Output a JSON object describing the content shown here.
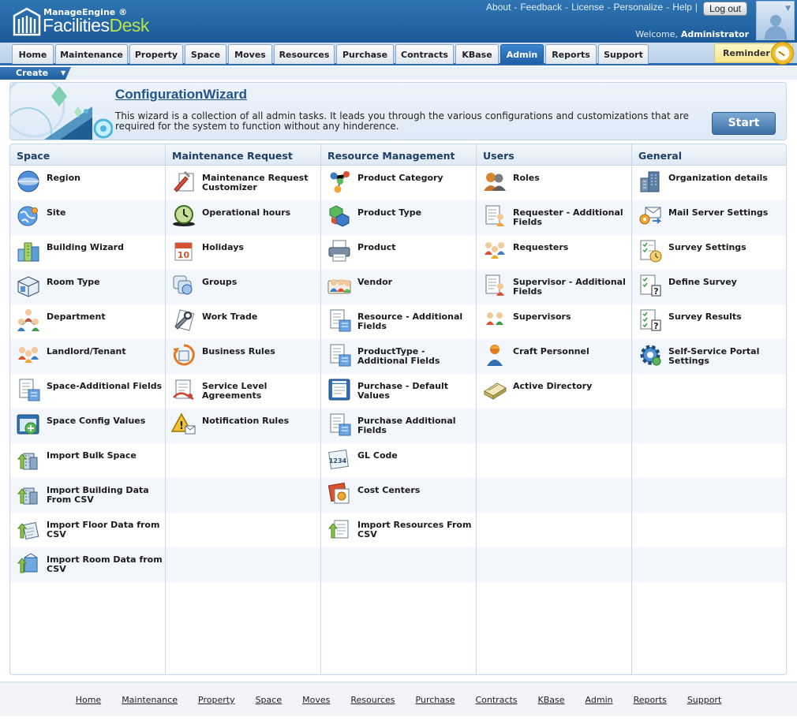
{
  "header": {
    "brand_small": "ManageEngine ®",
    "brand_big_a": "Facilities",
    "brand_big_b": "Desk",
    "top_links": [
      "About",
      "Feedback",
      "License",
      "Personalize",
      "Help"
    ],
    "logout_label": "Log out",
    "welcome_label": "Welcome,",
    "user_name": "Administrator"
  },
  "tabs": [
    {
      "label": "Home"
    },
    {
      "label": "Maintenance"
    },
    {
      "label": "Property"
    },
    {
      "label": "Space"
    },
    {
      "label": "Moves"
    },
    {
      "label": "Resources"
    },
    {
      "label": "Purchase"
    },
    {
      "label": "Contracts"
    },
    {
      "label": "KBase"
    },
    {
      "label": "Admin",
      "active": true
    },
    {
      "label": "Reports"
    },
    {
      "label": "Support"
    }
  ],
  "reminder_label": "Reminder",
  "create_label": "Create",
  "wizard": {
    "title": "ConfigurationWizard",
    "description": "This wizard is a collection of all admin tasks. It leads you through the various configurations and customizations that are required for the system to function without any hinderence.",
    "start_label": "Start"
  },
  "columns": [
    {
      "title": "Space",
      "items": [
        {
          "label": "Region",
          "icon": "globe-icon"
        },
        {
          "label": "Site",
          "icon": "site-globe-icon"
        },
        {
          "label": "Building Wizard",
          "icon": "buildings-icon"
        },
        {
          "label": "Room Type",
          "icon": "room-box-icon"
        },
        {
          "label": "Department",
          "icon": "department-people-icon"
        },
        {
          "label": "Landlord/Tenant",
          "icon": "people-group-icon"
        },
        {
          "label": "Space-Additional Fields",
          "icon": "additional-fields-icon"
        },
        {
          "label": "Space Config Values",
          "icon": "config-window-icon"
        },
        {
          "label": "Import Bulk Space",
          "icon": "import-building-icon"
        },
        {
          "label": "Import Building Data From CSV",
          "icon": "import-building-icon"
        },
        {
          "label": "Import Floor Data from CSV",
          "icon": "import-floor-icon"
        },
        {
          "label": "Import Room Data from CSV",
          "icon": "import-room-icon"
        }
      ]
    },
    {
      "title": "Maintenance Request",
      "items": [
        {
          "label": "Maintenance Request Customizer",
          "icon": "request-customizer-icon"
        },
        {
          "label": "Operational hours",
          "icon": "clock-icon"
        },
        {
          "label": "Holidays",
          "icon": "calendar-icon"
        },
        {
          "label": "Groups",
          "icon": "groups-icon"
        },
        {
          "label": "Work Trade",
          "icon": "work-trade-icon"
        },
        {
          "label": "Business Rules",
          "icon": "business-rules-icon"
        },
        {
          "label": "Service Level Agreements",
          "icon": "sla-icon"
        },
        {
          "label": "Notification Rules",
          "icon": "warning-icon"
        }
      ]
    },
    {
      "title": "Resource Management",
      "items": [
        {
          "label": "Product Category",
          "icon": "molecule-icon"
        },
        {
          "label": "Product Type",
          "icon": "cubes-icon"
        },
        {
          "label": "Product",
          "icon": "printer-icon"
        },
        {
          "label": "Vendor",
          "icon": "vendor-icon"
        },
        {
          "label": "Resource - Additional Fields",
          "icon": "additional-fields-icon"
        },
        {
          "label": "ProductType - Additional Fields",
          "icon": "additional-fields-icon"
        },
        {
          "label": "Purchase - Default Values",
          "icon": "invoice-icon"
        },
        {
          "label": "Purchase Additional Fields",
          "icon": "additional-fields-icon"
        },
        {
          "label": "GL Code",
          "icon": "gl-code-icon"
        },
        {
          "label": "Cost Centers",
          "icon": "cost-centers-icon"
        },
        {
          "label": "Import Resources From CSV",
          "icon": "import-resources-icon"
        }
      ]
    },
    {
      "title": "Users",
      "items": [
        {
          "label": "Roles",
          "icon": "roles-icon"
        },
        {
          "label": "Requester - Additional Fields",
          "icon": "requester-fields-icon"
        },
        {
          "label": "Requesters",
          "icon": "requesters-icon"
        },
        {
          "label": "Supervisor - Additional Fields",
          "icon": "supervisor-fields-icon"
        },
        {
          "label": "Supervisors",
          "icon": "supervisors-icon"
        },
        {
          "label": "Craft Personnel",
          "icon": "craft-personnel-icon"
        },
        {
          "label": "Active Directory",
          "icon": "active-directory-icon"
        }
      ]
    },
    {
      "title": "General",
      "items": [
        {
          "label": "Organization details",
          "icon": "organization-building-icon"
        },
        {
          "label": "Mail Server Settings",
          "icon": "mail-server-icon"
        },
        {
          "label": "Survey Settings",
          "icon": "survey-settings-icon"
        },
        {
          "label": "Define Survey",
          "icon": "define-survey-icon"
        },
        {
          "label": "Survey Results",
          "icon": "survey-results-icon"
        },
        {
          "label": "Self-Service Portal Settings",
          "icon": "gear-icon"
        }
      ]
    }
  ],
  "footer_links": [
    "Home",
    "Maintenance",
    "Property",
    "Space",
    "Moves",
    "Resources",
    "Purchase",
    "Contracts",
    "KBase",
    "Admin",
    "Reports",
    "Support"
  ]
}
